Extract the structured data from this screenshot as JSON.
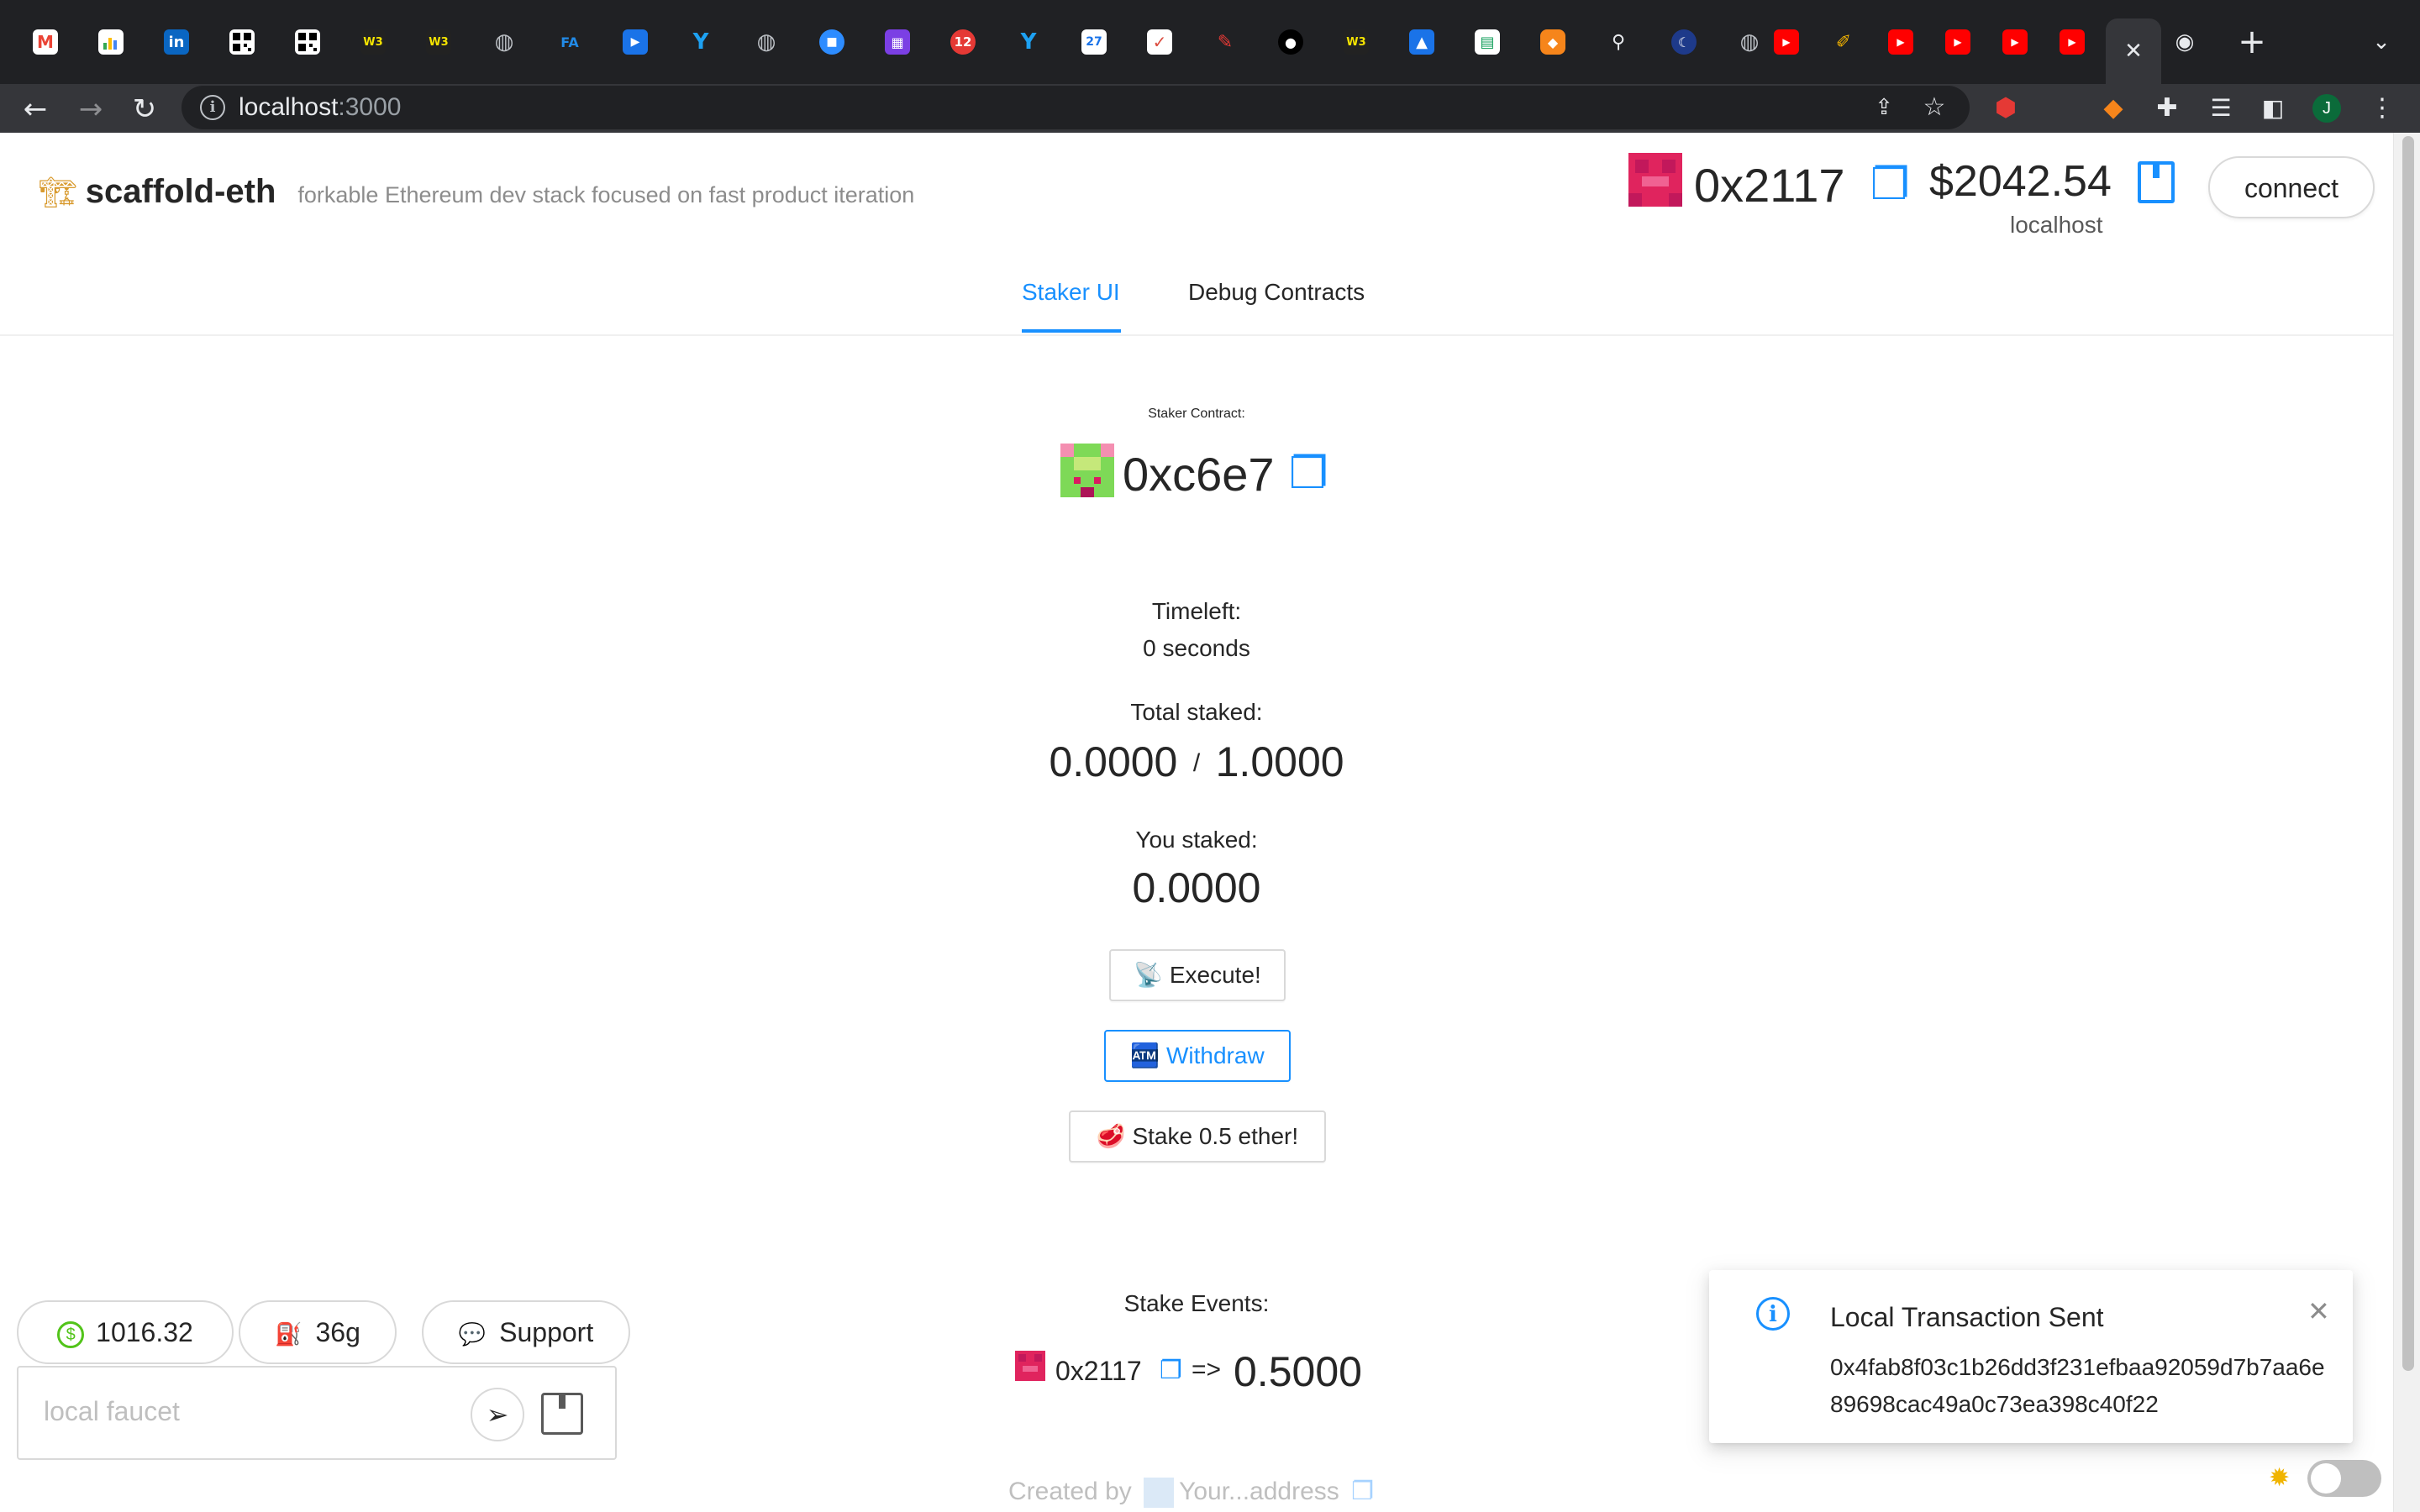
{
  "browser": {
    "tab_favicons": [
      "gmail-icon",
      "sheets-icon",
      "linkedin-icon",
      "qr-icon",
      "qr-icon",
      "web3-icon",
      "web3-icon",
      "globe-icon",
      "fa-icon",
      "video-icon",
      "y-icon",
      "globe-icon",
      "zoom-icon",
      "store-icon",
      "calendar-badge-icon",
      "y-icon",
      "calendar-icon",
      "todo-icon",
      "pin-icon",
      "github-icon",
      "web3-icon",
      "drive-icon",
      "app-icon",
      "metamask-icon",
      "telescope-icon",
      "moon-icon",
      "globe-icon",
      "youtube-icon",
      "ruler-icon",
      "youtube-icon",
      "youtube-icon",
      "youtube-icon",
      "youtube-icon",
      "close-icon",
      "chrome-icon"
    ],
    "calendar_badge": "12",
    "calendar_date": "27",
    "fa_label": "FA",
    "url_host": "localhost",
    "url_port": ":3000",
    "profile_initial": "J"
  },
  "header": {
    "brand": "scaffold-eth",
    "tagline": "forkable Ethereum dev stack focused on fast product iteration",
    "account_address": "0x2117",
    "balance": "$2042.54",
    "network": "localhost",
    "connect_label": "connect"
  },
  "menu": {
    "items": [
      {
        "label": "Staker UI",
        "active": true
      },
      {
        "label": "Debug Contracts",
        "active": false
      }
    ]
  },
  "staker": {
    "contract_label": "Staker Contract:",
    "contract_address": "0xc6e7",
    "timeleft_label": "Timeleft:",
    "timeleft_value": "0 seconds",
    "total_staked_label": "Total staked:",
    "total_staked": "0.0000",
    "separator": "/",
    "threshold": "1.0000",
    "you_staked_label": "You staked:",
    "you_staked": "0.0000",
    "execute_label": "📡 Execute!",
    "withdraw_label": "🏧 Withdraw",
    "stake_label": "🥩 Stake 0.5 ether!"
  },
  "events": {
    "title": "Stake Events:",
    "items": [
      {
        "address": "0x2117",
        "arrow": "=>",
        "amount": "0.5000"
      }
    ]
  },
  "bottom_left": {
    "price": "1016.32",
    "gas": "36g",
    "support": "Support",
    "faucet_placeholder": "local faucet"
  },
  "notification": {
    "title": "Local Transaction Sent",
    "message": "0x4fab8f03c1b26dd3f231efbaa92059d7b7aa6e89698cac49a0c73ea398c40f22"
  },
  "footer": {
    "created_by": "Created by",
    "address": "Your...address"
  },
  "colors": {
    "accent": "#1890ff",
    "chrome_dark": "#202124",
    "chrome_toolbar": "#35363a",
    "blockie_pink": "#e0245e",
    "blockie_green": "#7ed957"
  }
}
